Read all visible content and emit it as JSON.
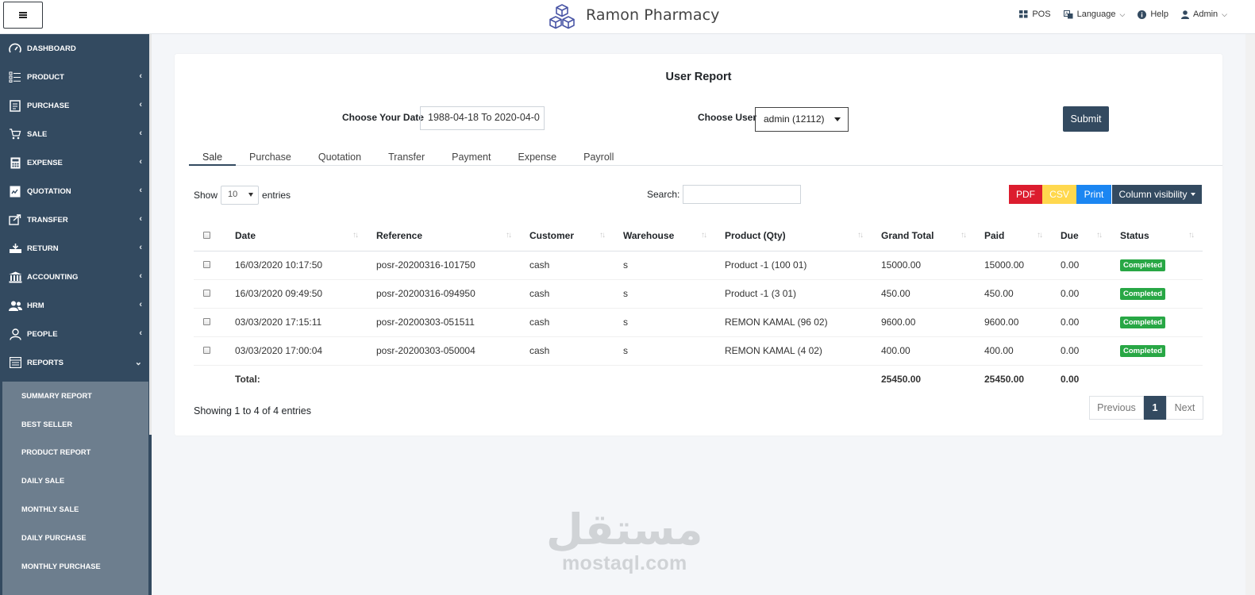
{
  "app": {
    "brand_name": "Ramon Pharmacy"
  },
  "topnav": {
    "pos": "POS",
    "language": "Language",
    "help": "Help",
    "user": "Admin"
  },
  "sidebar": {
    "items": [
      {
        "label": "DASHBOARD",
        "icon": "dashboard-icon",
        "chevron": ""
      },
      {
        "label": "PRODUCT",
        "icon": "list-icon",
        "chevron": "‹"
      },
      {
        "label": "PURCHASE",
        "icon": "receipt-icon",
        "chevron": "‹"
      },
      {
        "label": "SALE",
        "icon": "cart-icon",
        "chevron": "‹"
      },
      {
        "label": "EXPENSE",
        "icon": "calculator-icon",
        "chevron": "‹"
      },
      {
        "label": "QUOTATION",
        "icon": "document-icon",
        "chevron": "‹"
      },
      {
        "label": "TRANSFER",
        "icon": "share-icon",
        "chevron": "‹"
      },
      {
        "label": "RETURN",
        "icon": "return-icon",
        "chevron": "‹"
      },
      {
        "label": "ACCOUNTING",
        "icon": "bank-icon",
        "chevron": "‹"
      },
      {
        "label": "HRM",
        "icon": "users-icon",
        "chevron": "‹"
      },
      {
        "label": "PEOPLE",
        "icon": "person-icon",
        "chevron": "‹"
      },
      {
        "label": "REPORTS",
        "icon": "report-icon",
        "chevron": "⌄"
      }
    ],
    "submenu": [
      "SUMMARY REPORT",
      "BEST SELLER",
      "PRODUCT REPORT",
      "DAILY SALE",
      "MONTHLY SALE",
      "DAILY PURCHASE",
      "MONTHLY PURCHASE"
    ]
  },
  "report": {
    "title": "User Report",
    "date_label": "Choose Your Date",
    "date_value": "1988-04-18 To 2020-04-0",
    "user_label": "Choose User",
    "user_value": "admin (12112)",
    "submit_label": "Submit",
    "tabs": [
      "Sale",
      "Purchase",
      "Quotation",
      "Transfer",
      "Payment",
      "Expense",
      "Payroll"
    ],
    "active_tab": "Sale"
  },
  "table_controls": {
    "show_label": "Show",
    "entries_value": "10",
    "entries_label": "entries",
    "search_label": "Search:",
    "buttons": {
      "pdf": "PDF",
      "csv": "CSV",
      "print": "Print",
      "colvis": "Column visibility"
    }
  },
  "table": {
    "columns": [
      "Date",
      "Reference",
      "Customer",
      "Warehouse",
      "Product (Qty)",
      "Grand Total",
      "Paid",
      "Due",
      "Status"
    ],
    "rows": [
      {
        "date": "16/03/2020 10:17:50",
        "reference": "posr-20200316-101750",
        "customer": "cash",
        "warehouse": "s",
        "product": "Product -1 (100 01)",
        "grand_total": "15000.00",
        "paid": "15000.00",
        "due": "0.00",
        "status": "Completed"
      },
      {
        "date": "16/03/2020 09:49:50",
        "reference": "posr-20200316-094950",
        "customer": "cash",
        "warehouse": "s",
        "product": "Product -1 (3 01)",
        "grand_total": "450.00",
        "paid": "450.00",
        "due": "0.00",
        "status": "Completed"
      },
      {
        "date": "03/03/2020 17:15:11",
        "reference": "posr-20200303-051511",
        "customer": "cash",
        "warehouse": "s",
        "product": "REMON KAMAL (96 02)",
        "grand_total": "9600.00",
        "paid": "9600.00",
        "due": "0.00",
        "status": "Completed"
      },
      {
        "date": "03/03/2020 17:00:04",
        "reference": "posr-20200303-050004",
        "customer": "cash",
        "warehouse": "s",
        "product": "REMON KAMAL (4 02)",
        "grand_total": "400.00",
        "paid": "400.00",
        "due": "0.00",
        "status": "Completed"
      }
    ],
    "total": {
      "label": "Total:",
      "grand_total": "25450.00",
      "paid": "25450.00",
      "due": "0.00"
    },
    "info": "Showing 1 to 4 of 4 entries",
    "pagination": {
      "previous": "Previous",
      "current": "1",
      "next": "Next"
    }
  },
  "watermark": {
    "arabic": "مستقل",
    "latin": "mostaql.com"
  },
  "colors": {
    "sidebar": "#334a60",
    "submenu": "#6d7e8e",
    "accent": "#334a60",
    "pdf": "#dc1c2e",
    "csv": "#ffd84e",
    "print": "#1b86f2",
    "badge": "#28a745"
  }
}
